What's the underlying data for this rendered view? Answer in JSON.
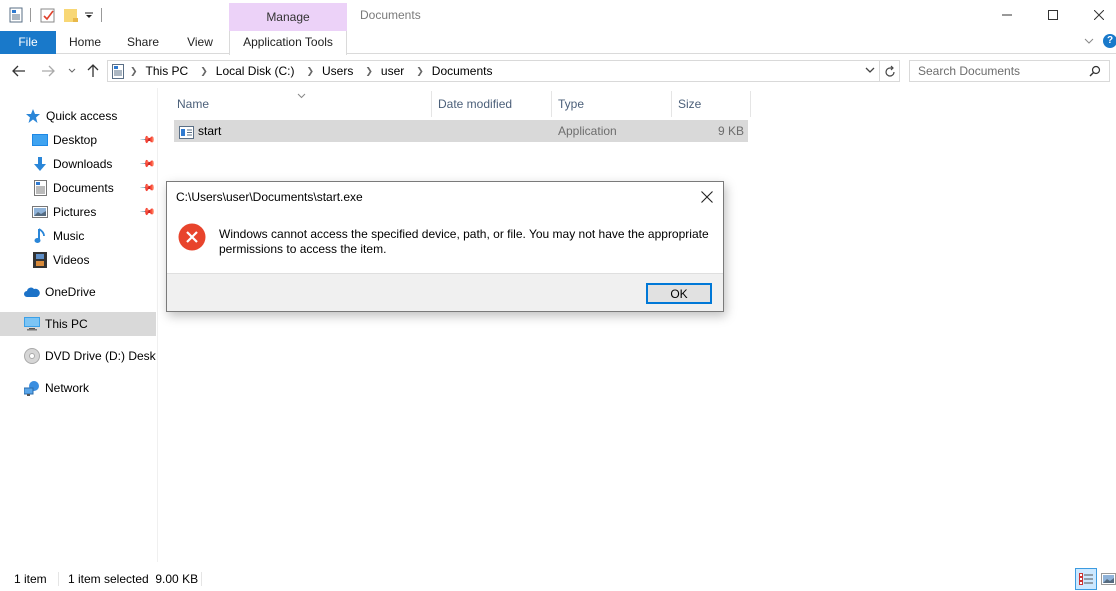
{
  "window": {
    "title": "Documents",
    "contextual_tab_group": "Manage",
    "controls": {
      "minimize": "minimize-icon",
      "maximize": "maximize-icon",
      "close": "close-icon"
    }
  },
  "quick_access_toolbar": {
    "icons": [
      "properties-icon",
      "checkmark-icon",
      "new-folder-icon",
      "customize-dropdown-icon"
    ]
  },
  "ribbon": {
    "tabs": [
      {
        "label": "File",
        "active": true
      },
      {
        "label": "Home"
      },
      {
        "label": "Share"
      },
      {
        "label": "View"
      },
      {
        "label": "Application Tools"
      }
    ],
    "accent": "#1979ca",
    "manage_color": "#ecd2f8"
  },
  "navigation": {
    "back": "back-arrow-icon",
    "forward": "forward-arrow-icon",
    "recent": "chevron-down-icon",
    "up": "up-arrow-icon"
  },
  "address_bar": {
    "breadcrumbs": [
      "This PC",
      "Local Disk (C:)",
      "Users",
      "user",
      "Documents"
    ]
  },
  "search": {
    "placeholder": "Search Documents"
  },
  "sidebar": {
    "quick_access": "Quick access",
    "items": [
      {
        "label": "Desktop",
        "pinned": true
      },
      {
        "label": "Downloads",
        "pinned": true
      },
      {
        "label": "Documents",
        "pinned": true
      },
      {
        "label": "Pictures",
        "pinned": true
      },
      {
        "label": "Music",
        "pinned": false
      },
      {
        "label": "Videos",
        "pinned": false
      }
    ],
    "onedrive": "OneDrive",
    "this_pc": "This PC",
    "dvd": "DVD Drive (D:) Deskto",
    "network": "Network"
  },
  "file_list": {
    "columns": [
      "Name",
      "Date modified",
      "Type",
      "Size"
    ],
    "rows": [
      {
        "name": "start",
        "date_modified": "",
        "type": "Application",
        "size": "9 KB",
        "selected": true
      }
    ]
  },
  "status_bar": {
    "item_count": "1 item",
    "selection": "1 item selected  9.00 KB"
  },
  "dialog": {
    "title": "C:\\Users\\user\\Documents\\start.exe",
    "message": "Windows cannot access the specified device, path, or file. You may not have the appropriate permissions to access the item.",
    "ok_label": "OK",
    "icon": "error-icon",
    "error_color": "#e81123"
  }
}
